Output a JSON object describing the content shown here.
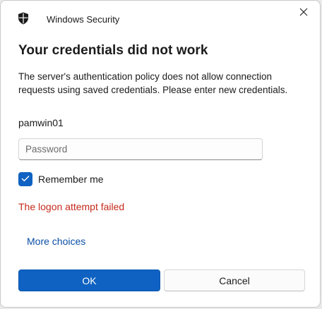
{
  "window": {
    "title": "Windows Security",
    "app_icon": "shield-icon",
    "close_icon": "close-icon"
  },
  "dialog": {
    "heading": "Your credentials did not work",
    "message": "The server's authentication policy does not allow connection requests using saved credentials. Please enter new credentials.",
    "username": "pamwin01",
    "password": {
      "value": "",
      "placeholder": "Password"
    },
    "remember_me": {
      "label": "Remember me",
      "checked": true
    },
    "error": "The logon attempt failed",
    "more_choices": "More choices",
    "buttons": {
      "ok": "OK",
      "cancel": "Cancel"
    }
  },
  "colors": {
    "accent": "#0f62c2",
    "error": "#c42b1c",
    "link": "#0a4ea5"
  }
}
